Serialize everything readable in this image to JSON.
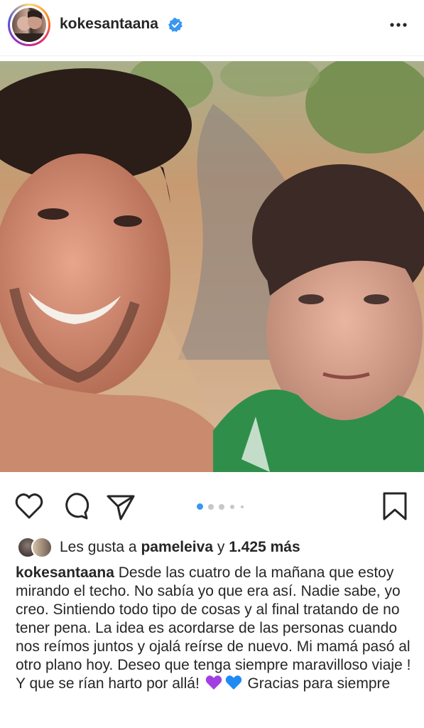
{
  "header": {
    "username": "kokesantaana",
    "verified_icon": "verified-badge-icon",
    "more_icon": "more-options-icon"
  },
  "post": {
    "carousel": {
      "count": 5,
      "active_index": 0
    }
  },
  "actions": {
    "like_icon": "heart-icon",
    "comment_icon": "comment-icon",
    "share_icon": "send-icon",
    "save_icon": "bookmark-icon"
  },
  "likes": {
    "prefix": "Les gusta a",
    "liker": "pameleiva",
    "connector": "y",
    "count": "1.425 más"
  },
  "caption": {
    "username": "kokesantaana",
    "text_part1": "Desde las cuatro de la mañana que estoy mirando el techo. No sabía yo que era así. Nadie sabe, yo creo. Sintiendo todo tipo de cosas y al final tratando de no tener pena. La idea es acordarse de las personas cuando nos reímos juntos y ojalá reírse de nuevo. Mi mamá pasó al otro plano hoy. Deseo que tenga siempre maravilloso viaje ! Y que se rían harto por allá!",
    "emoji1": "purple-heart",
    "emoji2": "blue-heart",
    "text_part2": "Gracias para siempre"
  },
  "colors": {
    "text": "#262626",
    "verified": "#3897f0",
    "dot_active": "#3897f0",
    "dot_inactive": "#c7c7c7",
    "purple_heart": "#a33fe0",
    "blue_heart": "#1f8bf2"
  }
}
